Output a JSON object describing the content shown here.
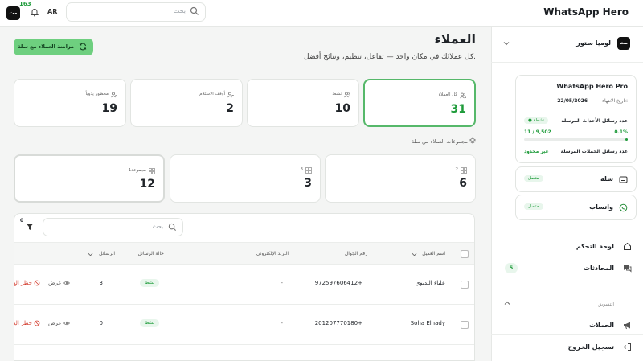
{
  "topbar": {
    "brand": "WhatsApp Hero",
    "search_placeholder": "بحث",
    "lang": "AR",
    "notifications_count": "163",
    "logo_text": "مت"
  },
  "sidebar": {
    "store": {
      "logo_text": "مت",
      "name": "لوميا ستور"
    },
    "plan": {
      "title": "WhatsApp Hero Pro",
      "expiry_label": "تاريخ الانتهاء:",
      "expiry_date": "22/05/2026",
      "events_label": "عدد رسائل الأحداث المرسلة",
      "active_label": "نشطة",
      "count": "11 / 9,502",
      "percent": "0.1%",
      "progress": 0.1,
      "campaigns_label": "عدد رسائل الحملات المرسلة",
      "unlimited": "غير محدود"
    },
    "integrations": [
      {
        "name": "سلة",
        "status": "متصل",
        "icon": "store-icon"
      },
      {
        "name": "واتساب",
        "status": "متصل",
        "icon": "whatsapp-icon"
      }
    ],
    "nav": {
      "dashboard": "لوحة التحكم",
      "conversations": "المحادثات",
      "conversations_count": "5",
      "marketing_section": "التسويق",
      "campaigns": "الحملات",
      "logout": "تسجيل الخروج"
    }
  },
  "main": {
    "title": "العملاء",
    "subtitle": "كل عملائك في مكان واحد — تفاعل، تنظيم، ونتائج أفضل.",
    "sync_button": "مزامنة العملاء مع سلة",
    "stats": [
      {
        "label": "كل العملاء",
        "value": "31"
      },
      {
        "label": "نشط",
        "value": "10"
      },
      {
        "label": "أوقف الاستلام",
        "value": "2"
      },
      {
        "label": "محظور يدوياً",
        "value": "19"
      }
    ],
    "groups_title": "مجموعات العملاء من سلة",
    "groups": [
      {
        "label": "2",
        "value": "6"
      },
      {
        "label": "3",
        "value": "3"
      },
      {
        "label": "مجموعة1",
        "value": "12"
      }
    ],
    "table": {
      "search_placeholder": "بحث",
      "filter_count": "0",
      "headers": {
        "name": "اسم العميل",
        "phone": "رقم الجوال",
        "email": "البريد الإلكتروني",
        "status": "حالة الرسائل",
        "messages": "الرسائل"
      },
      "rows": [
        {
          "name": "علياء البديوي",
          "phone": "972597606412+",
          "email": "-",
          "status": "نشط",
          "messages": "3",
          "view": "عرض",
          "ban": "حظر الع"
        },
        {
          "name": "Soha Elnady",
          "phone": "201207770180+",
          "email": "-",
          "status": "نشط",
          "messages": "0",
          "view": "عرض",
          "ban": "حظر الع"
        }
      ]
    }
  },
  "colors": {
    "accent": "#1e9b3a",
    "sync_bg": "#6ecf7f",
    "danger": "#d33a2c"
  }
}
